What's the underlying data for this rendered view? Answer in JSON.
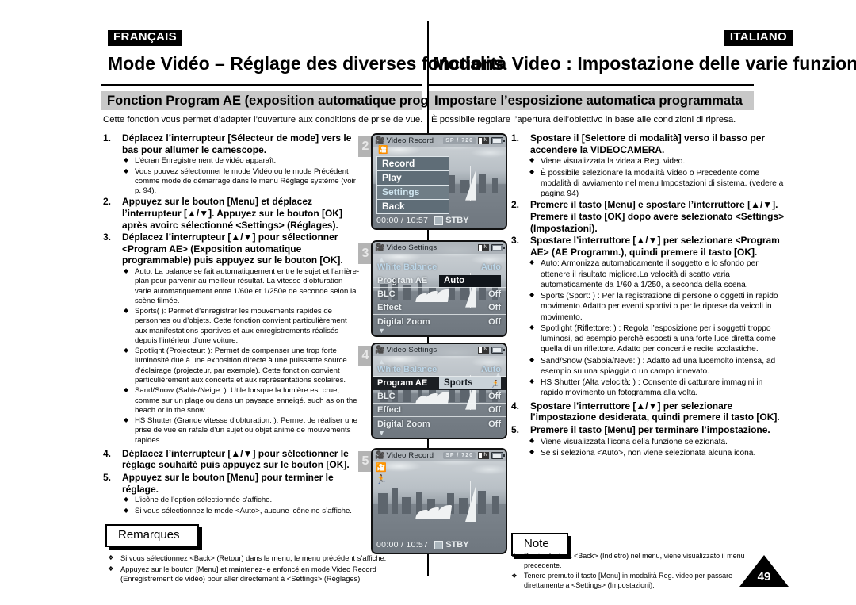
{
  "french": {
    "lang_tag": "FRANÇAIS",
    "title": "Mode Vidéo – Réglage des diverses fonctions",
    "section": "Fonction Program AE (exposition automatique programmable)",
    "intro": "Cette fonction vous permet d’adapter l’ouverture aux conditions de prise de vue.",
    "steps": [
      {
        "num": "1.",
        "lead": "Déplacez l’interrupteur [Sélecteur de mode] vers le bas pour allumer le camescope.",
        "bullets": [
          "L’écran Enregistrement de vidéo apparaît.",
          "Vous pouvez sélectionner le mode Vidéo ou le mode Précédent comme mode de démarrage dans le menu Réglage système (voir p. 94)."
        ]
      },
      {
        "num": "2.",
        "lead": "Appuyez sur le bouton [Menu] et déplacez l’interrupteur [▲/▼]. Appuyez sur le bouton [OK] après avoirc sélectionné <Settings> (Réglages).",
        "bullets": []
      },
      {
        "num": "3.",
        "lead": "Déplacez l’interrupteur [▲/▼] pour sélectionner <Program AE> (Exposition automatique programmable) puis appuyez sur le bouton [OK].",
        "bullets": [
          "Auto: La balance se fait automatiquement entre le sujet et l’arrière-plan pour parvenir au meilleur résultat. La vitesse d’obturation varie automatiquement entre 1/60e et 1/250e de seconde selon la scène filmée.",
          "Sports( ): Permet d’enregistrer les mouvements rapides de personnes ou d’objets. Cette fonction convient particulièrement aux manifestations sportives et aux enregistrements réalisés depuis l’intérieur d’une voiture.",
          "Spotlight (Projecteur: ): Permet de compenser une trop forte luminosité due à une exposition directe à une puissante source d’éclairage (projecteur, par exemple). Cette fonction convient particulièrement aux concerts et aux représentations scolaires.",
          "Sand/Snow (Sable/Neige: ): Utile lorsque la lumière est crue, comme sur un plage ou dans un paysage enneigé. such as on the beach or in the snow.",
          "HS Shutter (Grande vitesse d’obturation: ): Permet de réaliser une prise de vue en rafale d’un sujet ou objet animé de mouvements rapides."
        ]
      },
      {
        "num": "4.",
        "lead": "Déplacez l’interrupteur [▲/▼] pour sélectionner le réglage souhaité puis appuyez sur le bouton [OK].",
        "bullets": []
      },
      {
        "num": "5.",
        "lead": "Appuyez sur le bouton [Menu] pour terminer le réglage.",
        "bullets": [
          "L’icône de l’option sélectionnée s’affiche.",
          "Si vous sélectionnez le mode <Auto>, aucune icône ne s’affiche."
        ]
      }
    ],
    "notes_title": "Remarques",
    "notes": [
      "Si vous sélectionnez <Back> (Retour) dans le menu, le menu précédent s’affiche.",
      "Appuyez sur le bouton [Menu] et maintenez-le enfoncé en mode Video Record (Enregistrement de vidéo) pour aller directement à <Settings> (Réglages)."
    ]
  },
  "italian": {
    "lang_tag": "ITALIANO",
    "title": "Modalità Video : Impostazione delle varie funzioni",
    "section": "Impostare l’esposizione automatica programmata",
    "intro": "È possibile regolare l’apertura dell’obiettivo in base alle condizioni di ripresa.",
    "steps": [
      {
        "num": "1.",
        "lead": "Spostare il [Selettore di modalità] verso il basso per accendere la VIDEOCAMERA.",
        "bullets": [
          "Viene visualizzata la videata Reg. video.",
          "È possibile selezionare la modalità Video o Precedente come modalità di avviamento nel menu Impostazioni di sistema. (vedere a pagina 94)"
        ]
      },
      {
        "num": "2.",
        "lead": "Premere il tasto [Menu] e spostare l’interruttore [▲/▼]. Premere il tasto [OK] dopo avere selezionato <Settings> (Impostazioni).",
        "bullets": []
      },
      {
        "num": "3.",
        "lead": "Spostare l’interruttore [▲/▼] per selezionare <Program AE> (AE Programm.), quindi premere il tasto [OK].",
        "bullets": [
          "Auto: Armonizza automaticamente il soggetto e lo sfondo per ottenere il risultato migliore.La velocità di scatto varia automaticamente da 1/60 a 1/250, a seconda della scena.",
          "Sports (Sport: ) : Per la registrazione di persone o oggetti in rapido movimento.Adatto per eventi sportivi o per le riprese da veicoli in movimento.",
          "Spotlight (Riflettore: ) : Regola l’esposizione per i soggetti troppo luminosi, ad esempio perché esposti a una forte luce diretta come quella di un riflettore. Adatto per concerti e recite scolastiche.",
          "Sand/Snow (Sabbia/Neve: ) : Adatto ad una lucemolto intensa, ad esempio su una spiaggia o un campo innevato.",
          "HS Shutter (Alta velocità: ) : Consente di catturare immagini in rapido movimento un fotogramma alla volta."
        ]
      },
      {
        "num": "4.",
        "lead": "Spostare l’interruttore [▲/▼]  per selezionare l’impostazione desiderata, quindi premere il tasto [OK].",
        "bullets": []
      },
      {
        "num": "5.",
        "lead": "Premere il tasto [Menu] per terminare l’impostazione.",
        "bullets": [
          "Viene visualizzata l’icona della funzione selezionata.",
          "Se si seleziona <Auto>, non viene selezionata alcuna icona."
        ]
      }
    ],
    "notes_title": "Note",
    "notes": [
      "Se si seleziona <Back> (Indietro) nel menu, viene visualizzato il menu precedente.",
      "Tenere premuto il tasto [Menu] in modalità Reg. video per passare direttamente a <Settings> (Impostazioni)."
    ]
  },
  "page_number": "49",
  "screens": [
    {
      "badge": "2",
      "title": "Video Record",
      "quality": "SP",
      "resolution": "720",
      "timecode": "00:00 / 10:57",
      "status": "STBY",
      "menu_items": [
        {
          "label": "Record",
          "selected": false
        },
        {
          "label": "Play",
          "selected": false
        },
        {
          "label": "Settings",
          "selected": true
        },
        {
          "label": "Back",
          "selected": false
        }
      ]
    },
    {
      "badge": "3",
      "title": "Video Settings",
      "rows": [
        {
          "label": "White Balance",
          "value": "Auto",
          "highlight": false
        },
        {
          "label": "Program AE",
          "value": "Auto",
          "highlight": true
        },
        {
          "label": "BLC",
          "value": "Off",
          "highlight": false
        },
        {
          "label": "Effect",
          "value": "Off",
          "highlight": false
        },
        {
          "label": "Digital Zoom",
          "value": "Off",
          "highlight": false
        }
      ]
    },
    {
      "badge": "4",
      "title": "Video Settings",
      "rows": [
        {
          "label": "White Balance",
          "value": "Auto",
          "highlight": false
        },
        {
          "label": "Program AE",
          "value": "Sports",
          "highlight": true
        },
        {
          "label": "BLC",
          "value": "Off",
          "highlight": false
        },
        {
          "label": "Effect",
          "value": "Off",
          "highlight": false
        },
        {
          "label": "Digital Zoom",
          "value": "Off",
          "highlight": false
        }
      ]
    },
    {
      "badge": "5",
      "title": "Video Record",
      "quality": "SP",
      "resolution": "720",
      "timecode": "00:00 / 10:57",
      "status": "STBY"
    }
  ]
}
